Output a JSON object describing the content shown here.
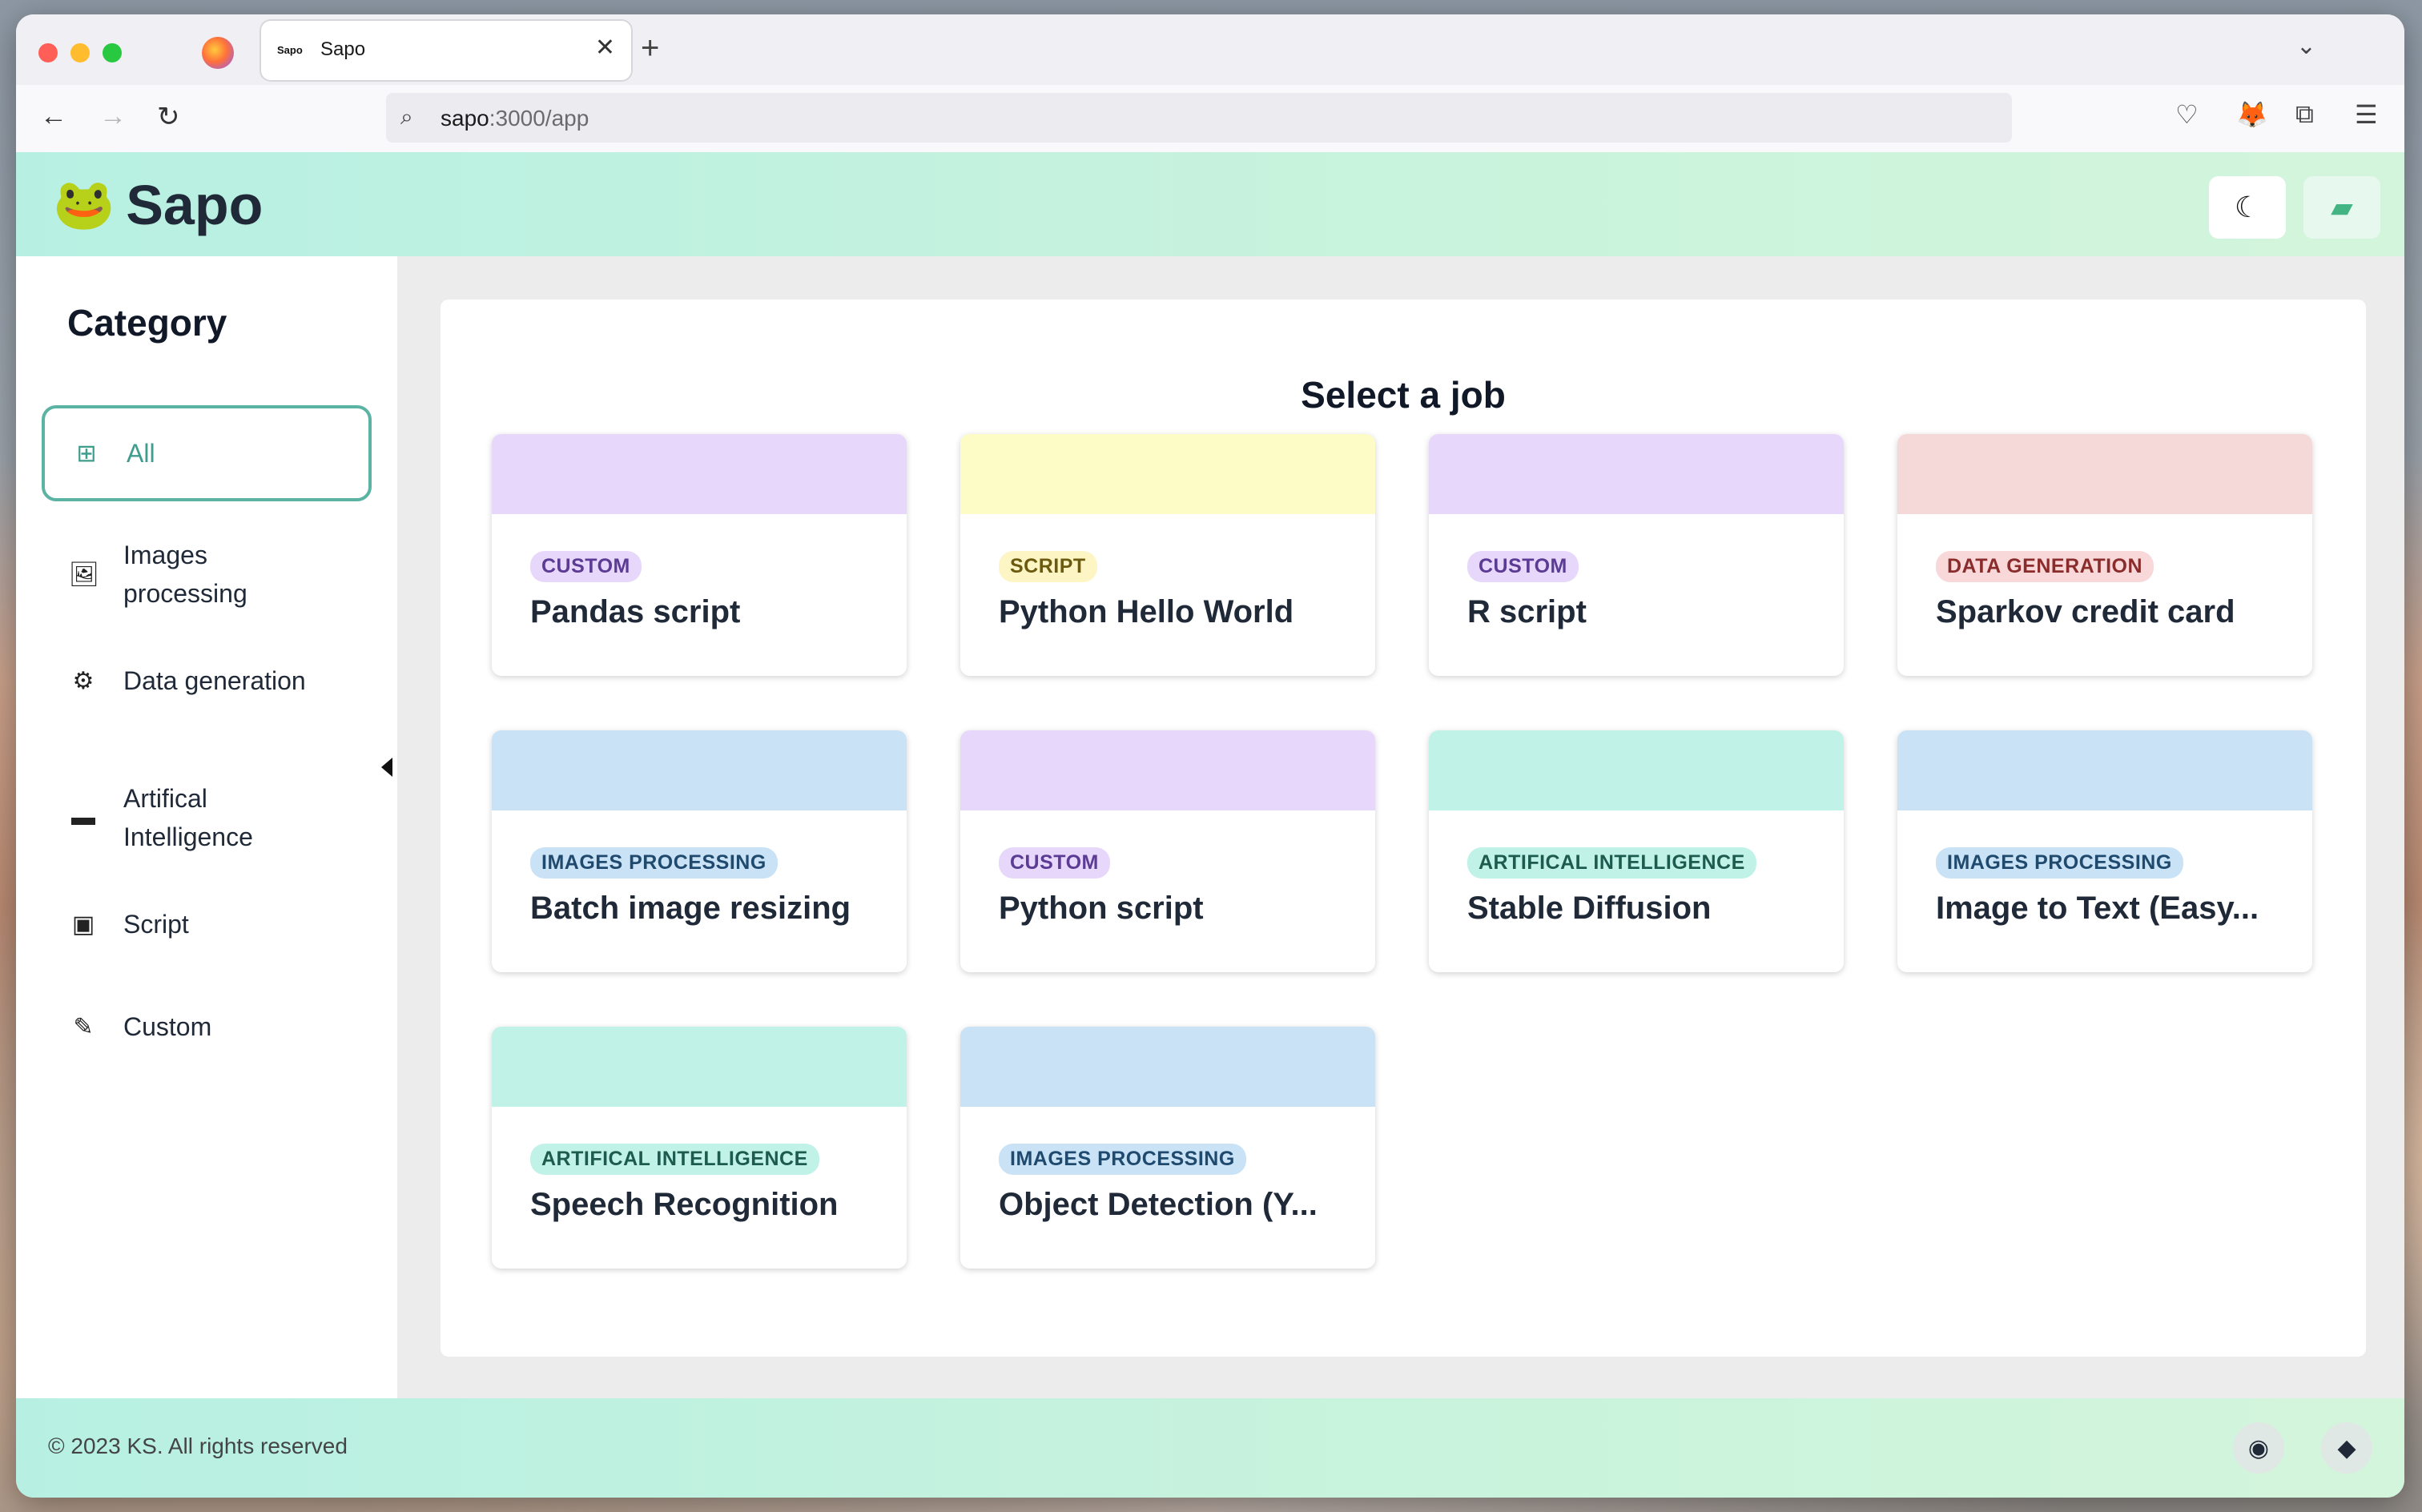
{
  "browser": {
    "tab_title": "Sapo",
    "tab_favicon_text": "Sapo",
    "url_host": "sapo",
    "url_rest": ":3000/app"
  },
  "header": {
    "brand_logo": "🐸",
    "brand_name": "Sapo"
  },
  "sidebar": {
    "title": "Category",
    "items": [
      {
        "label": "All",
        "icon": "grid-icon",
        "glyph": "⊞",
        "active": true
      },
      {
        "label": "Images processing",
        "icon": "images-icon",
        "glyph": "🖼",
        "active": false
      },
      {
        "label": "Data generation",
        "icon": "gears-icon",
        "glyph": "⚙",
        "active": false
      },
      {
        "label": "Artifical Intelligence",
        "icon": "hdd-icon",
        "glyph": "▬",
        "active": false
      },
      {
        "label": "Script",
        "icon": "frame-icon",
        "glyph": "▣",
        "active": false
      },
      {
        "label": "Custom",
        "icon": "pencil-icon",
        "glyph": "✎",
        "active": false
      }
    ]
  },
  "main": {
    "title": "Select a job",
    "cards": [
      {
        "badge": "CUSTOM",
        "title": "Pandas script"
      },
      {
        "badge": "SCRIPT",
        "title": "Python Hello World"
      },
      {
        "badge": "CUSTOM",
        "title": "R script"
      },
      {
        "badge": "DATA GENERATION",
        "title": "Sparkov credit card"
      },
      {
        "badge": "IMAGES PROCESSING",
        "title": "Batch image resizing"
      },
      {
        "badge": "CUSTOM",
        "title": "Python script"
      },
      {
        "badge": "ARTIFICAL INTELLIGENCE",
        "title": "Stable Diffusion"
      },
      {
        "badge": "IMAGES PROCESSING",
        "title": "Image to Text (Easy..."
      },
      {
        "badge": "ARTIFICAL INTELLIGENCE",
        "title": "Speech Recognition"
      },
      {
        "badge": "IMAGES PROCESSING",
        "title": "Object Detection (Y..."
      }
    ]
  },
  "footer": {
    "text": "© 2023 KS. All rights reserved"
  },
  "colors": {
    "accent": "#5bb3a4",
    "custom_band": "#e7d8fb",
    "script_band": "#fdfbc6",
    "data_band": "#f5d9d8",
    "images_band": "#c9e2f6",
    "ai_band": "#c1f2e8"
  }
}
